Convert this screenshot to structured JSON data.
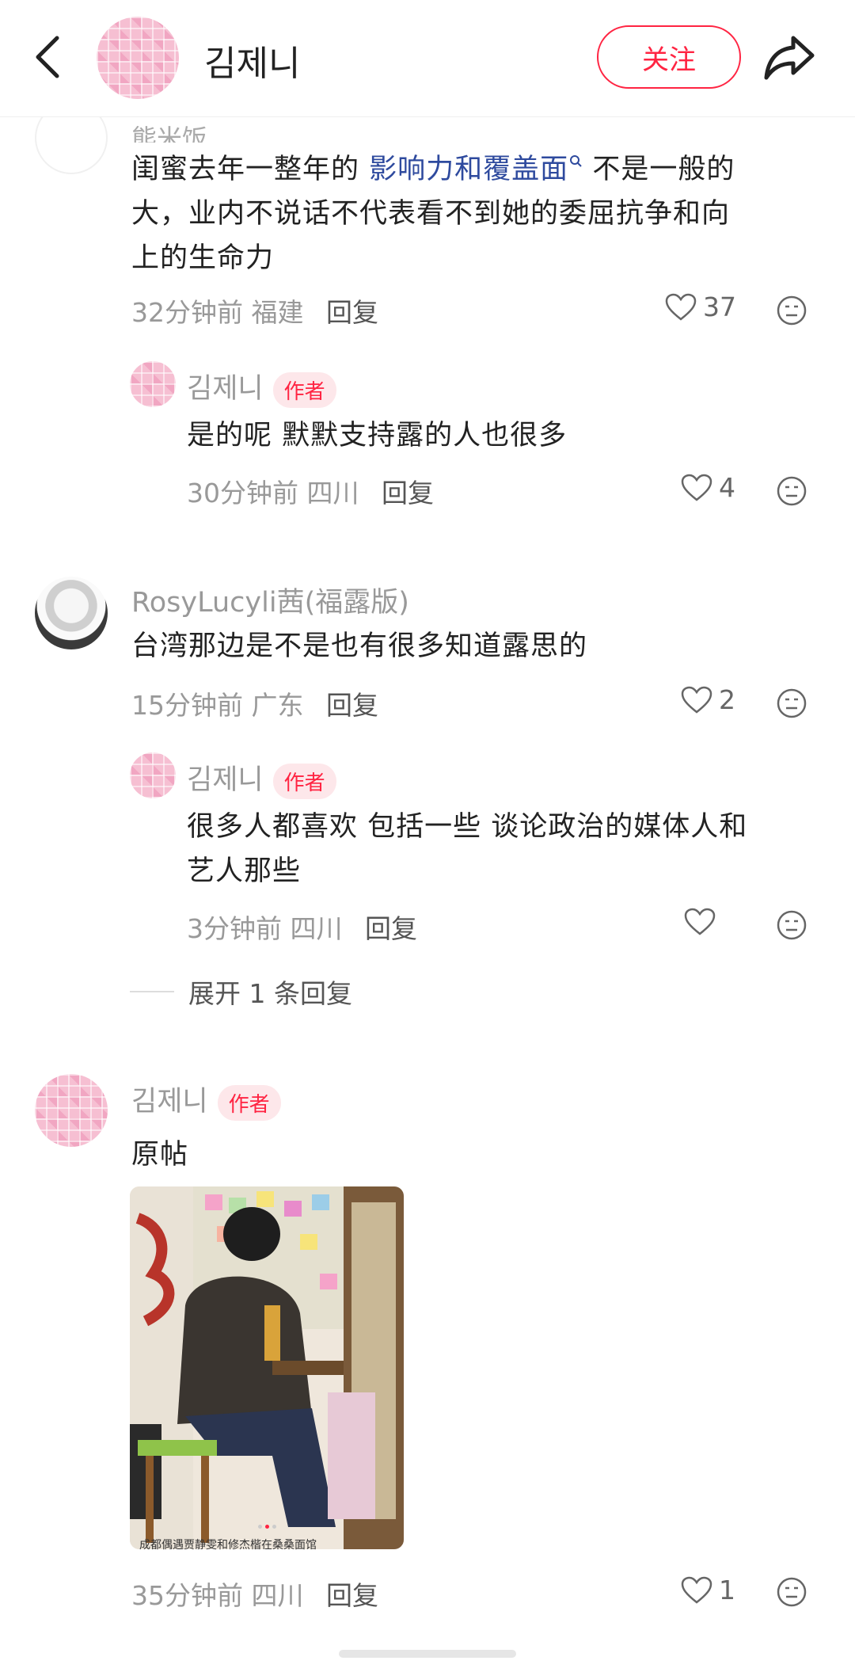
{
  "header": {
    "name": "김제니",
    "follow_label": "关注"
  },
  "comments": {
    "c1": {
      "cut_name": "熊米饭",
      "text_before": "闺蜜去年一整年的",
      "link": "影响力和覆盖面",
      "text_after_line1": "不是一般的",
      "text_line2": "大，业内不说话不代表看不到她的委屈抗争和向",
      "text_line3": "上的生命力",
      "time": "32分钟前",
      "location": "福建",
      "reply": "回复",
      "likes": "37"
    },
    "r1": {
      "name": "김제니",
      "badge": "作者",
      "text": "是的呢 默默支持露的人也很多",
      "time": "30分钟前",
      "location": "四川",
      "reply": "回复",
      "likes": "4"
    },
    "c2": {
      "name": "RosyLucyli茜(福露版)",
      "text": "台湾那边是不是也有很多知道露思的",
      "time": "15分钟前",
      "location": "广东",
      "reply": "回复",
      "likes": "2"
    },
    "r2": {
      "name": "김제니",
      "badge": "作者",
      "text_line1": "很多人都喜欢 包括一些 谈论政治的媒体人和",
      "text_line2": "艺人那些",
      "time": "3分钟前",
      "location": "四川",
      "reply": "回复"
    },
    "expand": "展开 1 条回复",
    "c3": {
      "name": "김제니",
      "badge": "作者",
      "text": "原帖",
      "photo_caption": "成都偶遇贾静雯和修杰楷在桑桑面馆",
      "time": "35分钟前",
      "location": "四川",
      "reply": "回复",
      "likes": "1"
    }
  },
  "colors": {
    "accent": "#ff2442",
    "link": "#2e4a9e",
    "meta": "#999999"
  },
  "icons": [
    "back-arrow-icon",
    "share-icon",
    "heart-icon",
    "emoji-icon"
  ]
}
